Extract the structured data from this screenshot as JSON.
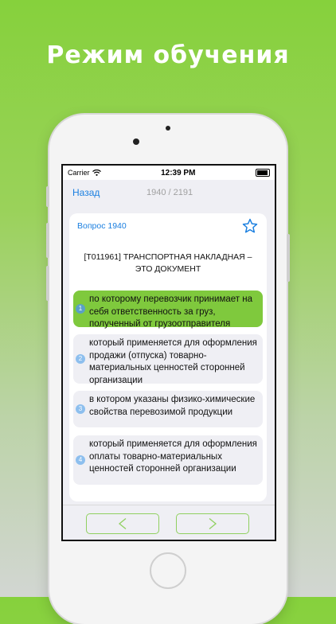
{
  "headline": "Режим обучения",
  "status": {
    "carrier": "Carrier",
    "time": "12:39 PM"
  },
  "nav": {
    "back_label": "Назад",
    "counter": "1940 / 2191"
  },
  "question": {
    "number_label": "Вопрос 1940",
    "text": "[T011961] ТРАНСПОРТНАЯ НАКЛАДНАЯ – ЭТО ДОКУМЕНТ"
  },
  "answers": [
    {
      "num": "1",
      "text": "по которому перевозчик принимает на себя ответственность за груз, полученный от грузоотправителя",
      "selected": true
    },
    {
      "num": "2",
      "text": "который применяется для оформления продажи (отпуска) товарно-материальных ценностей сторонней организации",
      "selected": false
    },
    {
      "num": "3",
      "text": "в котором указаны физико-химические свойства перевозимой продукции",
      "selected": false
    },
    {
      "num": "4",
      "text": "который применяется для оформления оплаты товарно-материальных ценностей сторонней организации",
      "selected": false
    }
  ],
  "colors": {
    "accent": "#1a7fe0",
    "correct": "#7fc93d",
    "button_border": "#90d060"
  },
  "icons": {
    "star": "star-outline-icon",
    "prev": "chevron-left-icon",
    "next": "chevron-right-icon"
  }
}
